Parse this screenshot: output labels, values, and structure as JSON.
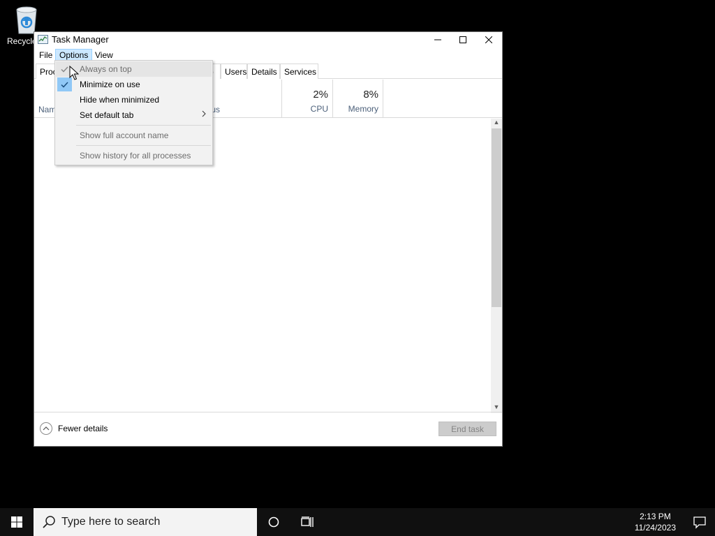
{
  "desktop": {
    "recycle_label": "Recycle"
  },
  "window": {
    "title": "Task Manager",
    "menu": [
      "File",
      "Options",
      "View"
    ],
    "tabs": [
      "Processes",
      "Startup",
      "Users",
      "Details",
      "Services"
    ],
    "tab_visible_text": {
      "processes": "Proc",
      "startup": "p"
    },
    "columns": {
      "name": "Name",
      "name_visible": "Nam",
      "status_visible": "tus",
      "cpu": {
        "pct": "2%",
        "label": "CPU"
      },
      "memory": {
        "pct": "8%",
        "label": "Memory"
      }
    },
    "footer": {
      "fewer_details": "Fewer details",
      "end_task": "End task"
    }
  },
  "options_menu": [
    {
      "label": "Always on top",
      "checked": true,
      "disabled": true
    },
    {
      "label": "Minimize on use",
      "checked": true,
      "disabled": false
    },
    {
      "label": "Hide when minimized",
      "checked": false,
      "disabled": false
    },
    {
      "label": "Set default tab",
      "submenu": true
    },
    {
      "label": "Show full account name",
      "disabled": true
    },
    {
      "label": "Show history for all processes",
      "disabled": true
    }
  ],
  "taskbar": {
    "search_placeholder": "Type here to search",
    "time": "2:13 PM",
    "date": "11/24/2023"
  },
  "colors": {
    "menu_highlight": "#cce8ff",
    "check_bg": "#90c8f6",
    "taskbar": "#101010"
  }
}
